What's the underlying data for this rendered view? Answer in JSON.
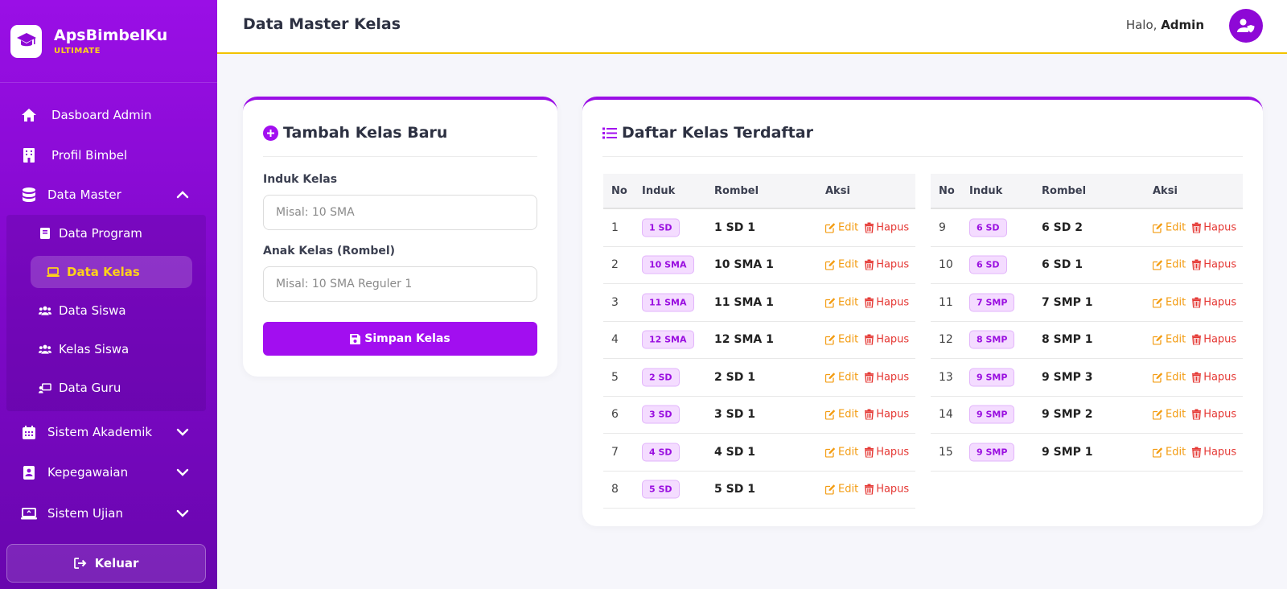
{
  "brand": {
    "name": "ApsBimbelKu",
    "subtitle": "ULTIMATE"
  },
  "sidebar": {
    "items": [
      {
        "label": "Dasboard Admin",
        "icon": "home-icon"
      },
      {
        "label": "Profil Bimbel",
        "icon": "building-icon"
      },
      {
        "label": "Data Master",
        "icon": "database-icon",
        "expanded": true
      },
      {
        "label": "Sistem Akademik",
        "icon": "calendar-icon"
      },
      {
        "label": "Kepegawaian",
        "icon": "id-badge-icon"
      },
      {
        "label": "Sistem Ujian",
        "icon": "laptop-icon"
      }
    ],
    "subitems": [
      {
        "label": "Data Program",
        "icon": "book-icon"
      },
      {
        "label": "Data Kelas",
        "icon": "laptop-icon",
        "active": true
      },
      {
        "label": "Data Siswa",
        "icon": "users-icon"
      },
      {
        "label": "Kelas Siswa",
        "icon": "users-icon"
      },
      {
        "label": "Data Guru",
        "icon": "chalkboard-teacher-icon"
      }
    ],
    "logout_label": "Keluar"
  },
  "header": {
    "title": "Data Master Kelas",
    "greeting": "Halo,",
    "user": "Admin"
  },
  "form": {
    "title": "Tambah Kelas Baru",
    "induk_label": "Induk Kelas",
    "induk_placeholder": "Misal: 10 SMA",
    "rombel_label": "Anak Kelas (Rombel)",
    "rombel_placeholder": "Misal: 10 SMA Reguler 1",
    "submit_label": "Simpan Kelas"
  },
  "list": {
    "title": "Daftar Kelas Terdaftar",
    "columns": [
      "No",
      "Induk",
      "Rombel",
      "Aksi"
    ],
    "edit_label": "Edit",
    "delete_label": "Hapus",
    "rows_left": [
      {
        "no": "1",
        "induk": "1 SD",
        "rombel": "1 SD 1"
      },
      {
        "no": "2",
        "induk": "10 SMA",
        "rombel": "10 SMA 1"
      },
      {
        "no": "3",
        "induk": "11 SMA",
        "rombel": "11 SMA 1"
      },
      {
        "no": "4",
        "induk": "12 SMA",
        "rombel": "12 SMA 1"
      },
      {
        "no": "5",
        "induk": "2 SD",
        "rombel": "2 SD 1"
      },
      {
        "no": "6",
        "induk": "3 SD",
        "rombel": "3 SD 1"
      },
      {
        "no": "7",
        "induk": "4 SD",
        "rombel": "4 SD 1"
      },
      {
        "no": "8",
        "induk": "5 SD",
        "rombel": "5 SD 1"
      }
    ],
    "rows_right": [
      {
        "no": "9",
        "induk": "6 SD",
        "rombel": "6 SD 2"
      },
      {
        "no": "10",
        "induk": "6 SD",
        "rombel": "6 SD 1"
      },
      {
        "no": "11",
        "induk": "7 SMP",
        "rombel": "7 SMP 1"
      },
      {
        "no": "12",
        "induk": "8 SMP",
        "rombel": "8 SMP 1"
      },
      {
        "no": "13",
        "induk": "9 SMP",
        "rombel": "9 SMP 3"
      },
      {
        "no": "14",
        "induk": "9 SMP",
        "rombel": "9 SMP 2"
      },
      {
        "no": "15",
        "induk": "9 SMP",
        "rombel": "9 SMP 1"
      }
    ]
  },
  "colors": {
    "primary": "#9b0fe6",
    "accent": "#ffd21a",
    "edit": "#f39c12",
    "delete": "#e53935"
  }
}
